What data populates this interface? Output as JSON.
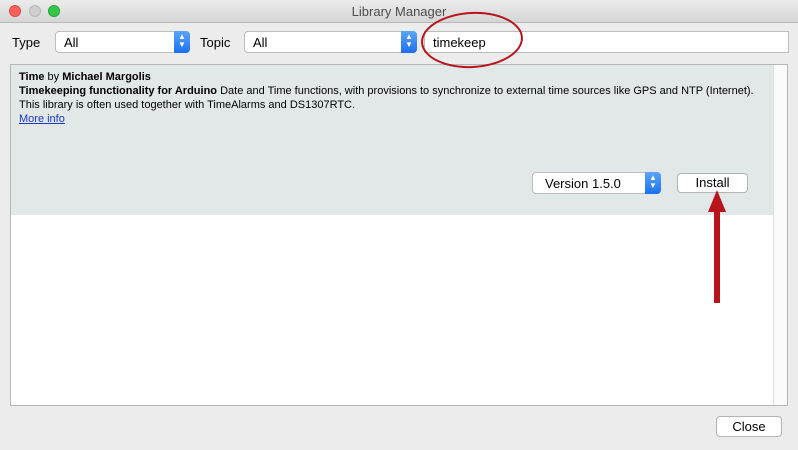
{
  "window": {
    "title": "Library Manager"
  },
  "filters": {
    "type_label": "Type",
    "type_value": "All",
    "topic_label": "Topic",
    "topic_value": "All",
    "search_value": "timekeep"
  },
  "library": {
    "name": "Time",
    "by": "by",
    "author": "Michael Margolis",
    "sentence": "Timekeeping functionality for Arduino",
    "description": " Date and Time functions, with provisions to synchronize to external time sources like GPS and NTP (Internet). This library is often used together with TimeAlarms and DS1307RTC.",
    "more_info": "More info",
    "version": "Version 1.5.0",
    "install_label": "Install"
  },
  "footer": {
    "close_label": "Close"
  },
  "colors": {
    "annotation": "#b8141b",
    "row_background": "#e2e8e8",
    "link": "#1a37c8",
    "accent": "#1d6ff2"
  },
  "icons": {
    "select_arrows": "chevron-updown-icon",
    "annotation_arrow": "arrow-up-icon"
  }
}
